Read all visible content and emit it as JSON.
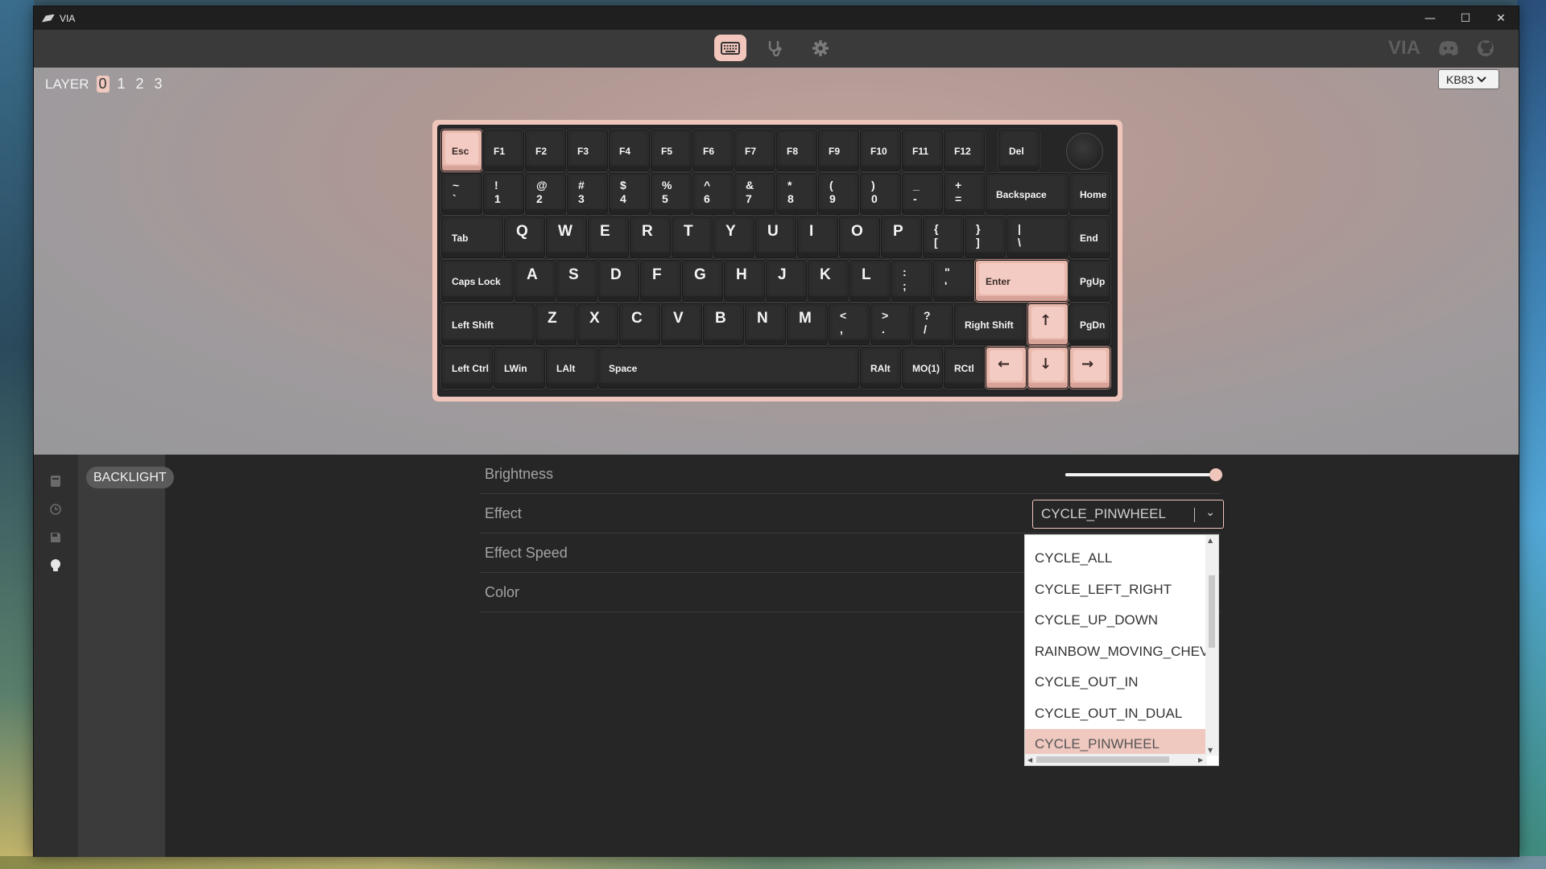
{
  "window": {
    "title": "VIA"
  },
  "win_controls": {
    "minimize": "—",
    "maximize": "☐",
    "close": "✕"
  },
  "toolbar": {
    "tabs": [
      {
        "name": "configure",
        "icon": "keyboard-icon",
        "active": true
      },
      {
        "name": "test",
        "icon": "stethoscope-icon",
        "active": false
      },
      {
        "name": "settings",
        "icon": "gear-icon",
        "active": false
      }
    ],
    "brand": "VIA"
  },
  "layers": {
    "label": "LAYER",
    "items": [
      "0",
      "1",
      "2",
      "3"
    ],
    "active": "0"
  },
  "keyboard_select": {
    "value": "KB83"
  },
  "keys": {
    "esc": "Esc",
    "f1": "F1",
    "f2": "F2",
    "f3": "F3",
    "f4": "F4",
    "f5": "F5",
    "f6": "F6",
    "f7": "F7",
    "f8": "F8",
    "f9": "F9",
    "f10": "F10",
    "f11": "F11",
    "f12": "F12",
    "del": "Del",
    "grave": "~\n`",
    "n1": "!\n1",
    "n2": "@\n2",
    "n3": "#\n3",
    "n4": "$\n4",
    "n5": "%\n5",
    "n6": "^\n6",
    "n7": "&\n7",
    "n8": "*\n8",
    "n9": "(\n9",
    "n0": ")\n0",
    "minus": "_\n-",
    "equal": "+\n=",
    "backspace": "Backspace",
    "home": "Home",
    "tab": "Tab",
    "q": "Q",
    "w": "W",
    "e": "E",
    "r": "R",
    "t": "T",
    "y": "Y",
    "u": "U",
    "i": "I",
    "o": "O",
    "p": "P",
    "lbracket": "{\n[",
    "rbracket": "}\n]",
    "backslash": "|\n\\",
    "end": "End",
    "caps": "Caps Lock",
    "a": "A",
    "s": "S",
    "d": "D",
    "f": "F",
    "g": "G",
    "h": "H",
    "j": "J",
    "k": "K",
    "l": "L",
    "semicolon": ":\n;",
    "quote": "\"\n'",
    "enter": "Enter",
    "pgup": "PgUp",
    "lshift": "Left Shift",
    "z": "Z",
    "x": "X",
    "c": "C",
    "v": "V",
    "b": "B",
    "n": "N",
    "m": "M",
    "comma": "<\n,",
    "period": ">\n.",
    "slash": "?\n/",
    "rshift": "Right Shift",
    "up": "↑",
    "pgdn": "PgDn",
    "lctrl": "Left Ctrl",
    "lwin": "LWin",
    "lalt": "LAlt",
    "space": "Space",
    "ralt": "RAlt",
    "mo1": "MO(1)",
    "rctl": "RCtl",
    "left": "←",
    "down": "↓",
    "right": "→"
  },
  "side_menu": {
    "active": "BACKLIGHT"
  },
  "settings": {
    "brightness": {
      "label": "Brightness",
      "value": 1.0
    },
    "effect": {
      "label": "Effect",
      "value": "CYCLE_PINWHEEL"
    },
    "effect_speed": {
      "label": "Effect Speed"
    },
    "color": {
      "label": "Color"
    }
  },
  "dropdown": {
    "options": [
      "CYCLE_ALL",
      "CYCLE_LEFT_RIGHT",
      "CYCLE_UP_DOWN",
      "RAINBOW_MOVING_CHEV",
      "CYCLE_OUT_IN",
      "CYCLE_OUT_IN_DUAL",
      "CYCLE_PINWHEEL"
    ],
    "selected": "CYCLE_PINWHEEL"
  },
  "colors": {
    "accent": "#f0c6bc",
    "panel": "#262626",
    "keycap": "#2e2e2e"
  }
}
